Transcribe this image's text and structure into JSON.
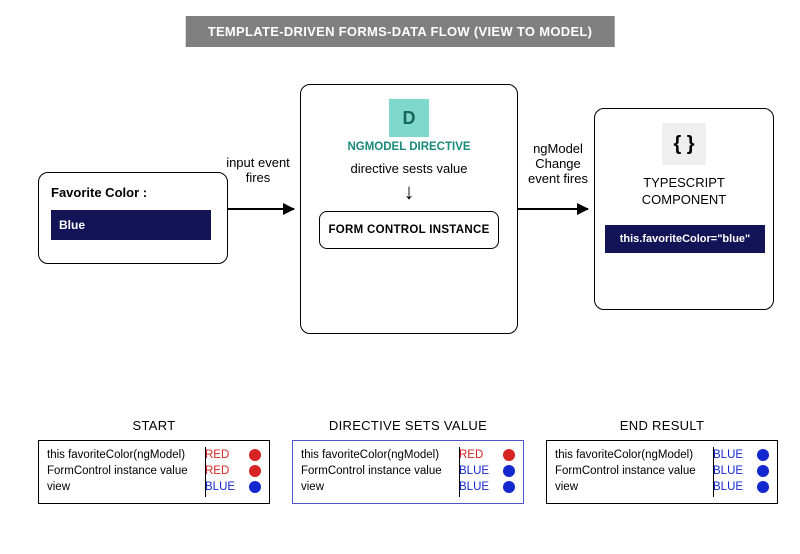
{
  "title": "TEMPLATE-DRIVEN FORMS-DATA FLOW (VIEW TO MODEL)",
  "left": {
    "label": "Favorite Color :",
    "value": "Blue"
  },
  "arrow1_label": "input event fires",
  "center": {
    "icon_letter": "D",
    "heading": "NGMODEL DIRECTIVE",
    "subtext": "directive sests value",
    "inner_box": "FORM CONTROL INSTANCE"
  },
  "arrow2_label": "ngModel Change event fires",
  "right": {
    "braces": "{ }",
    "heading": "TYPESCRIPT COMPONENT",
    "code": "this.favoriteColor=\"blue\""
  },
  "states": {
    "start": {
      "title": "START",
      "rows": [
        {
          "k": "this favoriteColor(ngModel)",
          "v": "RED",
          "c": "red"
        },
        {
          "k": "FormControl instance value",
          "v": "RED",
          "c": "red"
        },
        {
          "k": "view",
          "v": "BLUE",
          "c": "blue"
        }
      ]
    },
    "mid": {
      "title": "DIRECTIVE SETS VALUE",
      "rows": [
        {
          "k": "this favoriteColor(ngModel)",
          "v": "RED",
          "c": "red"
        },
        {
          "k": "FormControl instance value",
          "v": "BLUE",
          "c": "blue"
        },
        {
          "k": "view",
          "v": "BLUE",
          "c": "blue"
        }
      ]
    },
    "end": {
      "title": "END RESULT",
      "rows": [
        {
          "k": "this favoriteColor(ngModel)",
          "v": "BLUE",
          "c": "blue"
        },
        {
          "k": "FormControl instance value",
          "v": "BLUE",
          "c": "blue"
        },
        {
          "k": "view",
          "v": "BLUE",
          "c": "blue"
        }
      ]
    }
  }
}
